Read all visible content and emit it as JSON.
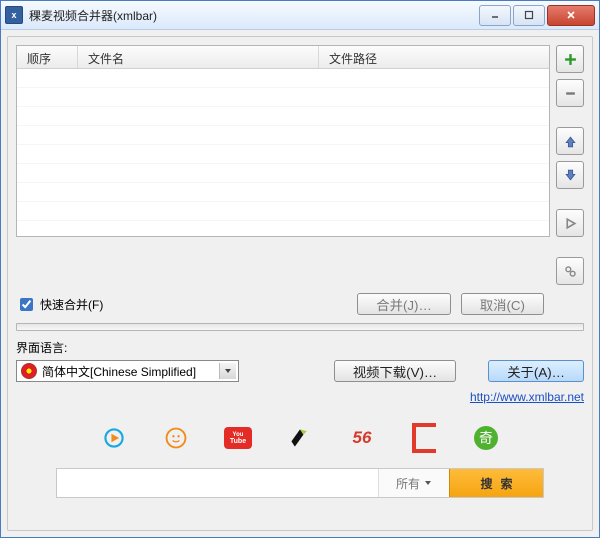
{
  "window": {
    "title": "稞麦视频合并器(xmlbar)"
  },
  "columns": {
    "order": "顺序",
    "name": "文件名",
    "path": "文件路径"
  },
  "side": {
    "add": "add-icon",
    "remove": "remove-icon",
    "up": "arrow-up-icon",
    "down": "arrow-down-icon",
    "play": "play-icon",
    "settings": "gear-icon"
  },
  "fastMerge": {
    "label": "快速合并(F)",
    "checked": true
  },
  "buttons": {
    "merge": "合并(J)…",
    "cancel": "取消(C)",
    "videoDownload": "视频下载(V)…",
    "about": "关于(A)…"
  },
  "language": {
    "label": "界面语言:",
    "selected": "简体中文[Chinese Simplified]"
  },
  "link": {
    "url": "http://www.xmlbar.net"
  },
  "logos": {
    "yt_top": "You",
    "yt_bottom": "Tube",
    "num56": "56",
    "qi": "奇"
  },
  "search": {
    "placeholder": "",
    "filter": "所有",
    "button": "搜索"
  }
}
